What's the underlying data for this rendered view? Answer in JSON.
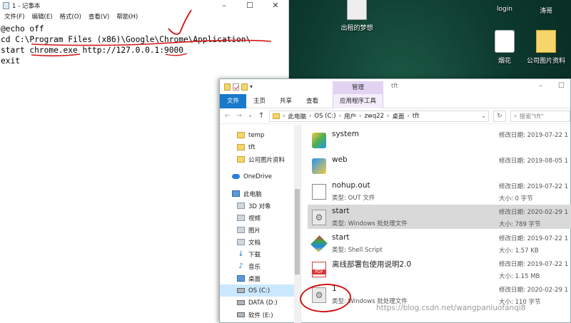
{
  "notepad": {
    "title": "1 - 记事本",
    "menu": [
      "文件(F)",
      "编辑(E)",
      "格式(O)",
      "查看(V)",
      "帮助(H)"
    ],
    "lines": [
      "@echo off",
      "cd C:\\Program Files (x86)\\Google\\Chrome\\Application\\",
      "start chrome.exe http://127.0.0.1:9000",
      "exit"
    ]
  },
  "desktop": {
    "icons": [
      {
        "label": "出租的梦想"
      },
      {
        "label": "login"
      },
      {
        "label": "涛哥"
      },
      {
        "label": "烟花"
      },
      {
        "label": "公司图片资料"
      }
    ]
  },
  "explorer": {
    "ribbon_tabs": [
      "文件",
      "主页",
      "共享",
      "查看"
    ],
    "context_group": "管理",
    "context_tab": "应用程序工具",
    "folder_name": "tft",
    "breadcrumb": [
      "此电脑",
      "OS (C:)",
      "用户",
      "zwq22",
      "桌面",
      "tft"
    ],
    "search_placeholder": "搜索\"tft\"",
    "tree": [
      {
        "label": "temp"
      },
      {
        "label": "tft"
      },
      {
        "label": "公司图片资料"
      },
      {
        "label": "OneDrive"
      },
      {
        "label": "此电脑"
      },
      {
        "label": "3D 对象"
      },
      {
        "label": "视频"
      },
      {
        "label": "图片"
      },
      {
        "label": "文档"
      },
      {
        "label": "下载"
      },
      {
        "label": "音乐"
      },
      {
        "label": "桌面"
      },
      {
        "label": "OS (C:)"
      },
      {
        "label": "DATA (D:)"
      },
      {
        "label": "软件 (E:)"
      }
    ],
    "files": [
      {
        "name": "system",
        "type": "",
        "date": "修改日期: 2019-07-22 1",
        "size": ""
      },
      {
        "name": "web",
        "type": "",
        "date": "修改日期: 2019-08-05 1",
        "size": ""
      },
      {
        "name": "nohup.out",
        "type": "类型: OUT 文件",
        "date": "修改日期: 2019-07-22 1",
        "size": "大小: 0 字节"
      },
      {
        "name": "start",
        "type": "类型: Windows 批处理文件",
        "date": "修改日期: 2020-02-29 1",
        "size": "大小: 789 字节"
      },
      {
        "name": "start",
        "type": "类型: Shell Script",
        "date": "修改日期: 2019-07-22 1",
        "size": "大小: 1.57 KB"
      },
      {
        "name": "离线部署包使用说明2.0",
        "type": "",
        "date": "修改日期: 2019-07-22 1",
        "size": "大小: 1.15 MB"
      },
      {
        "name": "1",
        "type": "类型: Windows 批处理文件",
        "date": "修改日期: 2020-02-29 1",
        "size": "大小: 110 字节"
      }
    ]
  },
  "watermark": "https://blog.csdn.net/wangpanluofanqi8",
  "colors": {
    "accent": "#1979ca",
    "annotation": "#d21414",
    "context_tab": "#e3d3f2"
  }
}
